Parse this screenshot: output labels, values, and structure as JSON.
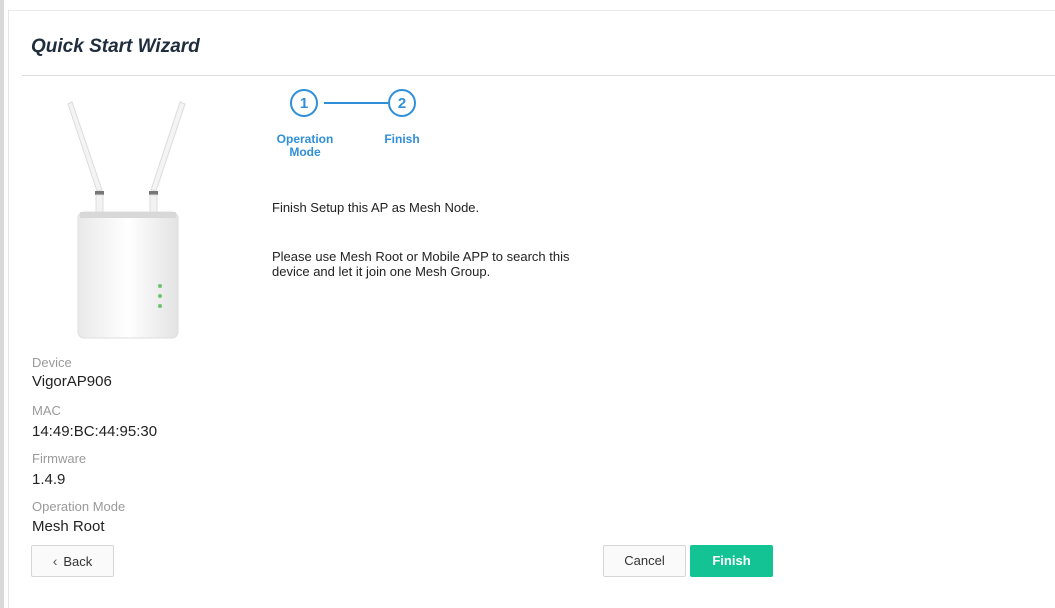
{
  "wizard": {
    "title": "Quick Start Wizard"
  },
  "steps": [
    {
      "number": "1",
      "label": "Operation Mode"
    },
    {
      "number": "2",
      "label": "Finish"
    }
  ],
  "content": {
    "line1": "Finish Setup this AP as Mesh Node.",
    "line2a": "Please use Mesh Root or Mobile APP to search this",
    "line2b": "device and let it join one Mesh Group."
  },
  "device_info": {
    "device_label": "Device",
    "device_value": "VigorAP906",
    "mac_label": "MAC",
    "mac_value": "14:49:BC:44:95:30",
    "firmware_label": "Firmware",
    "firmware_value": "1.4.9",
    "opmode_label": "Operation Mode",
    "opmode_value": "Mesh Root"
  },
  "buttons": {
    "back": "Back",
    "cancel": "Cancel",
    "finish": "Finish"
  },
  "colors": {
    "accent": "#2f8fd8",
    "finish": "#14c393"
  }
}
